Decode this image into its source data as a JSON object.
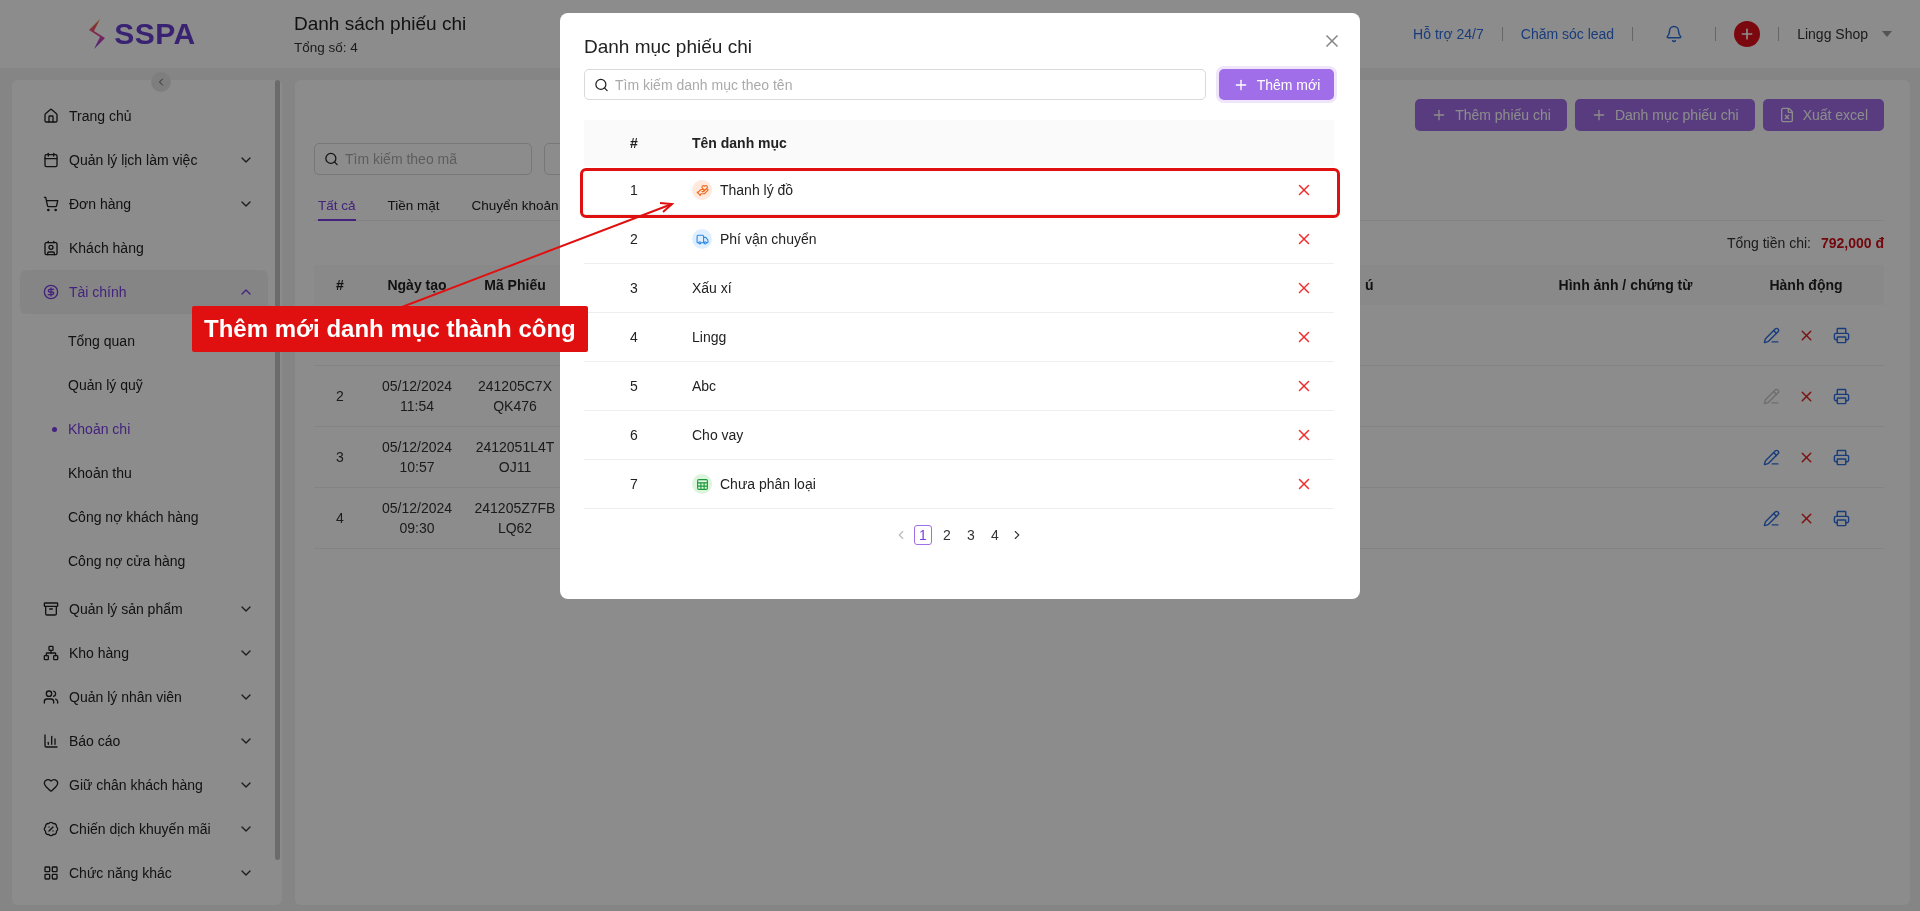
{
  "header": {
    "logo": "SSPA",
    "title": "Danh sách phiếu chi",
    "subtitle": "Tổng số: 4",
    "links": [
      "Hỗ trợ 24/7",
      "Chăm sóc lead"
    ],
    "shop": "Lingg Shop"
  },
  "sidebar": {
    "items": [
      {
        "label": "Trang chủ",
        "selected": false
      },
      {
        "label": "Quản lý lịch làm việc",
        "selected": false,
        "expanded": false
      },
      {
        "label": "Đơn hàng",
        "selected": false,
        "expanded": false
      },
      {
        "label": "Khách hàng",
        "selected": false
      },
      {
        "label": "Tài chính",
        "selected": true,
        "expanded": true,
        "children": [
          {
            "label": "Tổng quan",
            "selected": false
          },
          {
            "label": "Quản lý quỹ",
            "selected": false
          },
          {
            "label": "Khoản chi",
            "selected": true
          },
          {
            "label": "Khoản thu",
            "selected": false
          },
          {
            "label": "Công nợ khách hàng",
            "selected": false
          },
          {
            "label": "Công nợ cửa hàng",
            "selected": false
          }
        ]
      },
      {
        "label": "Quản lý sản phẩm",
        "selected": false,
        "expanded": false
      },
      {
        "label": "Kho hàng",
        "selected": false,
        "expanded": false
      },
      {
        "label": "Quản lý nhân viên",
        "selected": false,
        "expanded": false
      },
      {
        "label": "Báo cáo",
        "selected": false,
        "expanded": false
      },
      {
        "label": "Giữ chân khách hàng",
        "selected": false,
        "expanded": false
      },
      {
        "label": "Chiến dịch khuyến mãi",
        "selected": false,
        "expanded": false
      },
      {
        "label": "Chức năng khác",
        "selected": false,
        "expanded": false
      }
    ]
  },
  "toolbar": {
    "buttons": [
      {
        "label": "Thêm phiếu chi",
        "kind": "add"
      },
      {
        "label": "Danh mục phiếu chi",
        "kind": "add"
      },
      {
        "label": "Xuất excel",
        "kind": "export"
      }
    ]
  },
  "search": {
    "placeholder": "Tìm kiếm theo mã"
  },
  "tabs": [
    {
      "label": "Tất cả",
      "selected": true
    },
    {
      "label": "Tiền mặt",
      "selected": false
    },
    {
      "label": "Chuyển khoản",
      "selected": false
    }
  ],
  "total": {
    "label": "Tổng tiền chi:",
    "value": "792,000 đ"
  },
  "table": {
    "columns": [
      "#",
      "Ngày tạo",
      "Mã Phiếu",
      "ú",
      "Hình ảnh / chứng từ",
      "Hành động"
    ],
    "rows": [
      {
        "edit_disabled": false
      },
      {
        "number": "2",
        "date": "05/12/2024 11:54",
        "code": "241205C7X QK476",
        "edit_disabled": true
      },
      {
        "number": "3",
        "date": "05/12/2024 10:57",
        "code": "2412051L4T OJ11",
        "edit_disabled": false
      },
      {
        "number": "4",
        "date": "05/12/2024 09:30",
        "code": "241205Z7FB LQ62",
        "edit_disabled": false
      }
    ]
  },
  "modal": {
    "title": "Danh mục phiếu chi",
    "search_placeholder": "Tìm kiếm danh mục theo tên",
    "add_button": "Thêm mới",
    "columns": [
      "#",
      "Tên danh mục"
    ],
    "rows": [
      {
        "number": "1",
        "name": "Thanh lý đồ",
        "kind": "hand",
        "highlighted": true
      },
      {
        "number": "2",
        "name": "Phí vận chuyển",
        "kind": "truck",
        "highlighted": false
      },
      {
        "number": "3",
        "name": "Xấu xí",
        "kind": "plain",
        "highlighted": false
      },
      {
        "number": "4",
        "name": "Lingg",
        "kind": "plain",
        "highlighted": false
      },
      {
        "number": "5",
        "name": "Abc",
        "kind": "plain",
        "highlighted": false
      },
      {
        "number": "6",
        "name": "Cho vay",
        "kind": "plain",
        "highlighted": false
      },
      {
        "number": "7",
        "name": "Chưa phân loại",
        "kind": "grid",
        "highlighted": false
      }
    ],
    "pages": [
      {
        "label": "1",
        "selected": true
      },
      {
        "label": "2",
        "selected": false
      },
      {
        "label": "3",
        "selected": false
      },
      {
        "label": "4",
        "selected": false
      }
    ]
  },
  "annotation": {
    "text": "Thêm mới danh mục thành công"
  }
}
